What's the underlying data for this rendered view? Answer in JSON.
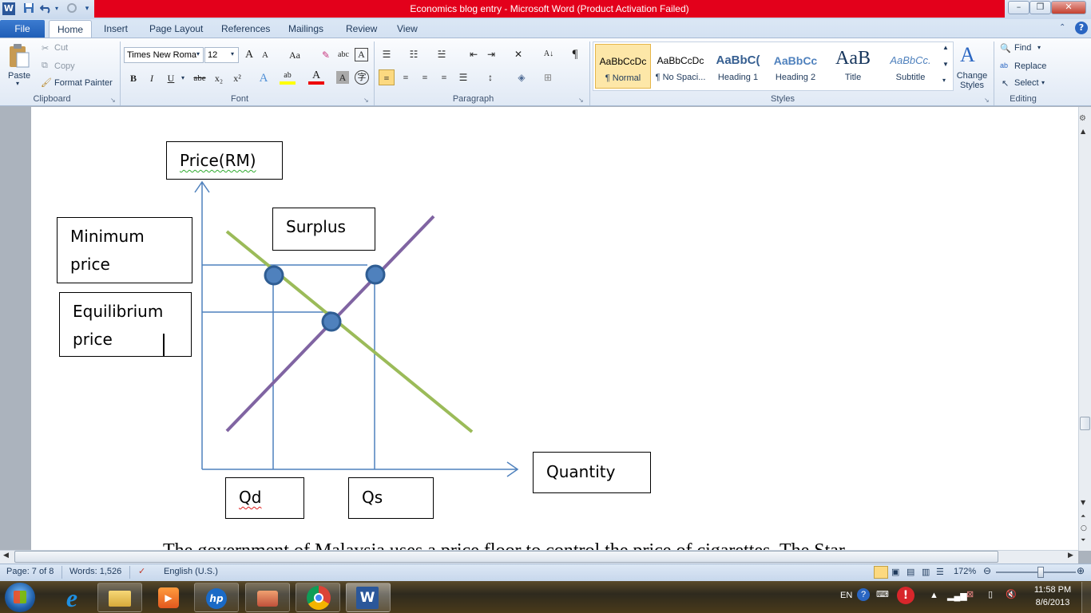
{
  "window": {
    "title": "Economics blog entry  -  Microsoft Word (Product Activation Failed)"
  },
  "qat": {
    "word_icon": "W",
    "save": "save-icon",
    "undo": "undo-icon",
    "redo": "redo-icon"
  },
  "window_controls": {
    "minimize": "–",
    "maximize": "❐",
    "close": "✕"
  },
  "tabs": {
    "file": "File",
    "home": "Home",
    "insert": "Insert",
    "page_layout": "Page Layout",
    "references": "References",
    "mailings": "Mailings",
    "review": "Review",
    "view": "View"
  },
  "clipboard": {
    "paste": "Paste",
    "cut": "Cut",
    "copy": "Copy",
    "format_painter": "Format Painter",
    "label": "Clipboard"
  },
  "font": {
    "name": "Times New Roma",
    "size": "12",
    "label": "Font",
    "bold": "B",
    "italic": "I",
    "underline": "U",
    "strike": "abe",
    "sub": "x₂",
    "sup": "x²",
    "grow": "A",
    "shrink": "A",
    "case": "Aa",
    "clear": "A",
    "color": "A"
  },
  "paragraph": {
    "label": "Paragraph",
    "pilcrow": "¶"
  },
  "styles": {
    "label": "Styles",
    "items": [
      {
        "sample": "AaBbCcDc",
        "name": "¶ Normal"
      },
      {
        "sample": "AaBbCcDc",
        "name": "¶ No Spaci..."
      },
      {
        "sample": "AaBbC(",
        "name": "Heading 1"
      },
      {
        "sample": "AaBbCc",
        "name": "Heading 2"
      },
      {
        "sample": "AaB",
        "name": "Title"
      },
      {
        "sample": "AaBbCc.",
        "name": "Subtitle"
      }
    ],
    "change_styles": "Change Styles"
  },
  "editing": {
    "label": "Editing",
    "find": "Find",
    "replace": "Replace",
    "select": "Select"
  },
  "diagram": {
    "price_axis": "Price(RM)",
    "quantity_axis": "Quantity",
    "surplus": "Surplus",
    "minimum_price_1": "Minimum",
    "minimum_price_2": "price",
    "equilibrium_price_1": "Equilibrium",
    "equilibrium_price_2": "price",
    "qd": "Qd",
    "qs": "Qs",
    "supply_color": "#8064a2",
    "demand_color": "#9bbb59",
    "guide_color": "#4f81bd"
  },
  "body_text": "The government of Malaysia uses a price floor to control the price of cigarettes. The Star",
  "status": {
    "page": "Page: 7 of 8",
    "words": "Words: 1,526",
    "language": "English (U.S.)",
    "zoom": "172%"
  },
  "tray": {
    "lang": "EN",
    "time": "11:58 PM",
    "date": "8/6/2013"
  }
}
